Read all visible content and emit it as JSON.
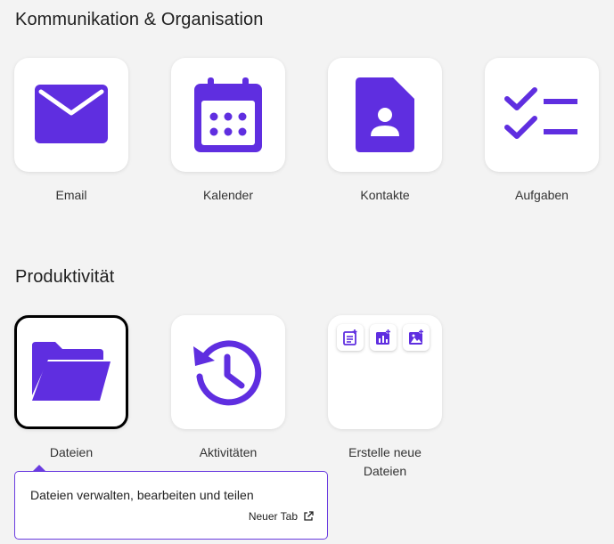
{
  "sections": [
    {
      "title": "Kommunikation & Organisation",
      "apps": [
        {
          "label": "Email",
          "icon": "mail-icon"
        },
        {
          "label": "Kalender",
          "icon": "calendar-icon"
        },
        {
          "label": "Kontakte",
          "icon": "contact-icon"
        },
        {
          "label": "Aufgaben",
          "icon": "checklist-icon"
        }
      ]
    },
    {
      "title": "Produktivität",
      "apps": [
        {
          "label": "Dateien",
          "icon": "folder-icon",
          "selected": true
        },
        {
          "label": "Aktivitäten",
          "icon": "history-icon"
        },
        {
          "label": "Erstelle neue Dateien",
          "icon": "create-files-icon"
        }
      ]
    }
  ],
  "tooltip": {
    "text": "Dateien verwalten, bearbeiten und teilen",
    "link_label": "Neuer Tab"
  },
  "colors": {
    "accent": "#5f2ee0",
    "background": "#f3f3f3",
    "tile": "#ffffff"
  }
}
